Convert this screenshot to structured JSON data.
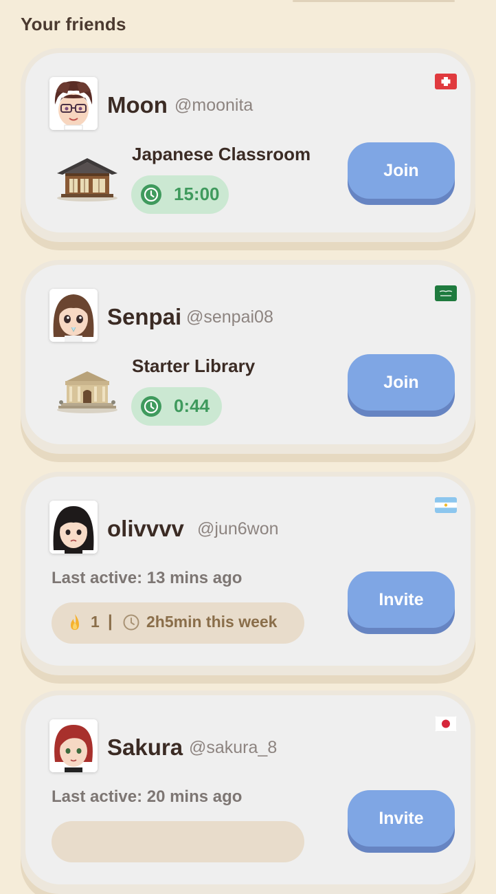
{
  "header": {
    "title": "Your friends"
  },
  "friends": [
    {
      "name": "Moon",
      "handle": "@moonita",
      "flag_icon": "switzerland-flag-icon",
      "room_name": "Japanese Classroom",
      "room_icon": "japanese-house-icon",
      "timer": "15:00",
      "action_label": "Join"
    },
    {
      "name": "Senpai",
      "handle": "@senpai08",
      "flag_icon": "saudi-arabia-flag-icon",
      "room_name": "Starter Library",
      "room_icon": "library-building-icon",
      "timer": "0:44",
      "action_label": "Join"
    },
    {
      "name": "olivvvv",
      "handle": "@jun6won",
      "flag_icon": "argentina-flag-icon",
      "last_active": "Last active: 13 mins ago",
      "streak": "1",
      "separator": "|",
      "week_time": "2h5min this week",
      "action_label": "Invite"
    },
    {
      "name": "Sakura",
      "handle": "@sakura_8",
      "flag_icon": "japan-flag-icon",
      "last_active": "Last active: 20 mins ago",
      "action_label": "Invite"
    }
  ],
  "colors": {
    "background": "#f5ecd9",
    "card": "#efefef",
    "button": "#7fa6e4",
    "timer_pill": "#cbe8d2",
    "timer_text": "#3f9a5d",
    "stats_pill": "#e8dccb"
  }
}
